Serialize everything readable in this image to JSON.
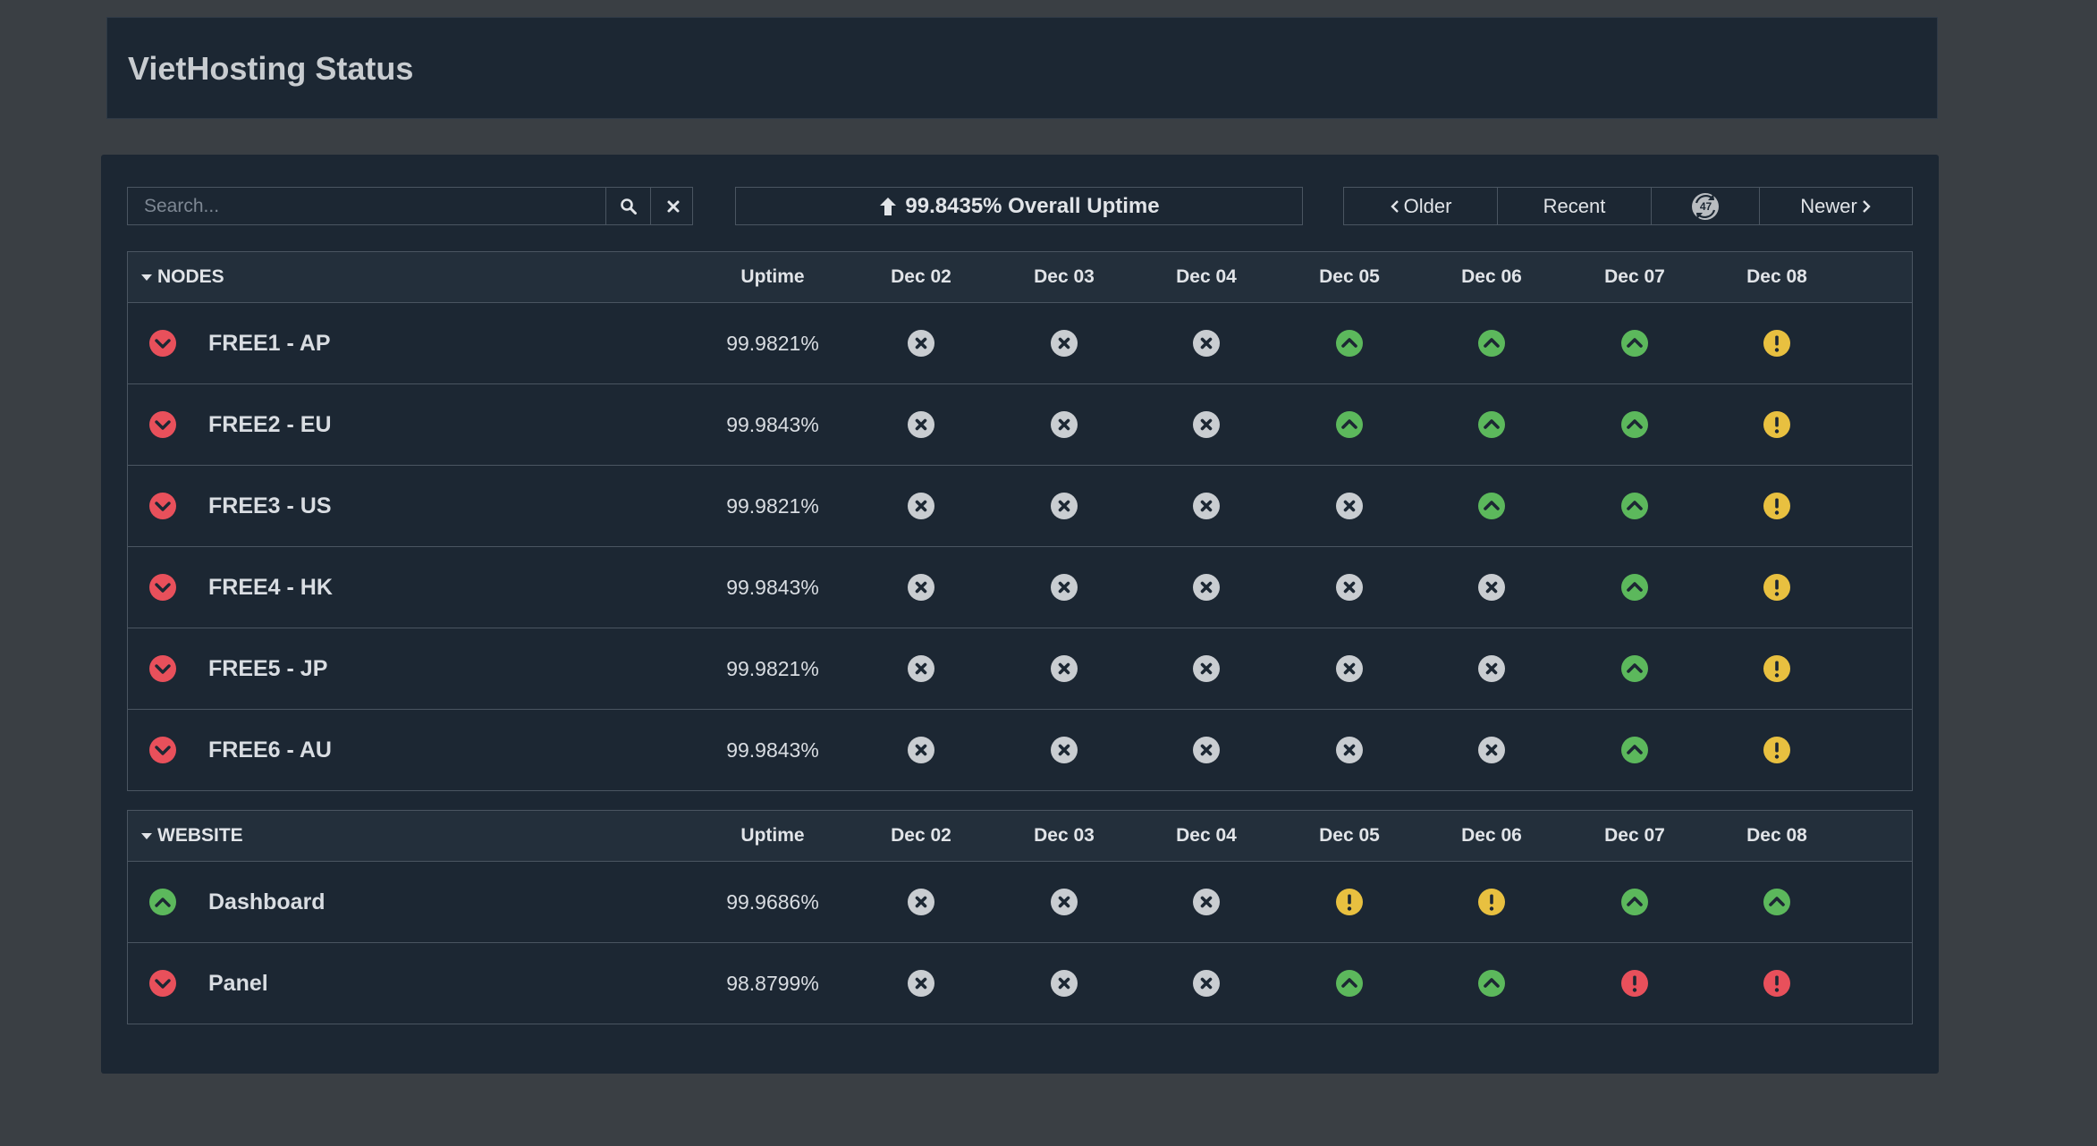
{
  "app": {
    "title": "VietHosting Status"
  },
  "toolbar": {
    "search_placeholder": "Search...",
    "overall_uptime": "99.8435% Overall Uptime",
    "pager": {
      "older": "Older",
      "recent": "Recent",
      "refresh_count": "47",
      "newer": "Newer"
    }
  },
  "colors": {
    "up": "#5cb85c",
    "down": "#e8505b",
    "warn": "#e8c040",
    "none": "#c9cdd1",
    "panel": "#1c2733"
  },
  "columns": {
    "uptime": "Uptime",
    "days": [
      "Dec 02",
      "Dec 03",
      "Dec 04",
      "Dec 05",
      "Dec 06",
      "Dec 07",
      "Dec 08"
    ]
  },
  "groups": [
    {
      "name": "NODES",
      "rows": [
        {
          "name": "FREE1 - AP",
          "state": "down",
          "uptime": "99.9821%",
          "days": [
            "none",
            "none",
            "none",
            "up",
            "up",
            "up",
            "warn"
          ]
        },
        {
          "name": "FREE2 - EU",
          "state": "down",
          "uptime": "99.9843%",
          "days": [
            "none",
            "none",
            "none",
            "up",
            "up",
            "up",
            "warn"
          ]
        },
        {
          "name": "FREE3 - US",
          "state": "down",
          "uptime": "99.9821%",
          "days": [
            "none",
            "none",
            "none",
            "none",
            "up",
            "up",
            "warn"
          ]
        },
        {
          "name": "FREE4 - HK",
          "state": "down",
          "uptime": "99.9843%",
          "days": [
            "none",
            "none",
            "none",
            "none",
            "none",
            "up",
            "warn"
          ]
        },
        {
          "name": "FREE5 - JP",
          "state": "down",
          "uptime": "99.9821%",
          "days": [
            "none",
            "none",
            "none",
            "none",
            "none",
            "up",
            "warn"
          ]
        },
        {
          "name": "FREE6 - AU",
          "state": "down",
          "uptime": "99.9843%",
          "days": [
            "none",
            "none",
            "none",
            "none",
            "none",
            "up",
            "warn"
          ]
        }
      ]
    },
    {
      "name": "WEBSITE",
      "rows": [
        {
          "name": "Dashboard",
          "state": "up",
          "uptime": "99.9686%",
          "days": [
            "none",
            "none",
            "none",
            "warn",
            "warn",
            "up",
            "up"
          ]
        },
        {
          "name": "Panel",
          "state": "down",
          "uptime": "98.8799%",
          "days": [
            "none",
            "none",
            "none",
            "up",
            "up",
            "down",
            "down"
          ]
        }
      ]
    }
  ]
}
